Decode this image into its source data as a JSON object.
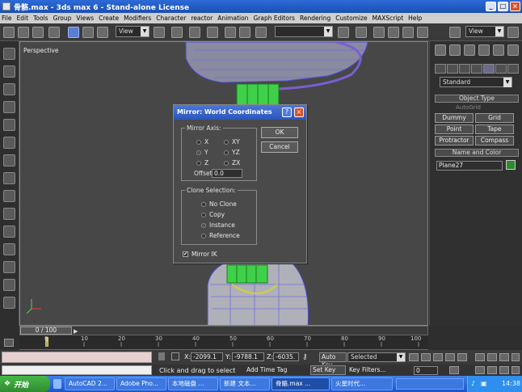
{
  "window": {
    "title": "骨骼.max - 3ds max 6 - Stand-alone License",
    "min": "_",
    "max": "□",
    "close": "×"
  },
  "menu": [
    "File",
    "Edit",
    "Tools",
    "Group",
    "Views",
    "Create",
    "Modifiers",
    "Character",
    "reactor",
    "Animation",
    "Graph Editors",
    "Rendering",
    "Customize",
    "MAXScript",
    "Help"
  ],
  "toolbar": {
    "ref_coord": "View",
    "selection_set": "",
    "view_right": "View"
  },
  "viewport": {
    "label": "Perspective"
  },
  "command_panel": {
    "category": "Standard",
    "object_type_header": "Object Type",
    "autogrid_label": "AutoGrid",
    "buttons": [
      "Dummy",
      "Grid",
      "Point",
      "Tape",
      "Protractor",
      "Compass"
    ],
    "name_color_header": "Name and Color",
    "object_name": "Plane27",
    "object_color": "#2e8b2e"
  },
  "dialog": {
    "title": "Mirror: World Coordinates",
    "help": "?",
    "close": "×",
    "mirror_axis_label": "Mirror Axis:",
    "axes": [
      {
        "label": "X",
        "selected": false
      },
      {
        "label": "Y",
        "selected": true
      },
      {
        "label": "Z",
        "selected": false
      },
      {
        "label": "XY",
        "selected": false
      },
      {
        "label": "YZ",
        "selected": false
      },
      {
        "label": "ZX",
        "selected": false
      }
    ],
    "offset_label": "Offset:",
    "offset_value": "0.0",
    "ok": "OK",
    "cancel": "Cancel",
    "clone_label": "Clone Selection:",
    "clone_options": [
      {
        "label": "No Clone",
        "selected": false
      },
      {
        "label": "Copy",
        "selected": false
      },
      {
        "label": "Instance",
        "selected": true
      },
      {
        "label": "Reference",
        "selected": false
      }
    ],
    "mirror_ik_label": "Mirror IK",
    "mirror_ik_checked": "✔"
  },
  "timeline": {
    "slider": "0 / 100",
    "ticks": [
      "0",
      "10",
      "20",
      "30",
      "40",
      "50",
      "60",
      "70",
      "80",
      "90",
      "100"
    ]
  },
  "status": {
    "x_label": "X:",
    "x_value": "-2099.1",
    "y_label": "Y:",
    "y_value": "-9788.1",
    "z_label": "Z:",
    "z_value": "-6035.",
    "prompt": "Click and drag to select",
    "add_time_tag": "Add Time Tag",
    "auto_key": "Auto Key",
    "set_key": "Set Key",
    "key_mode": "Selected",
    "key_filters": "Key Filters...",
    "frame": "0"
  },
  "taskbar": {
    "start": "开始",
    "tasks": [
      "AutoCAD 2...",
      "Adobe Pho...",
      "本地磁盘 ...",
      "新建 文本...",
      "骨骼.max ...",
      "火星时代..."
    ],
    "clock": "14:38"
  }
}
